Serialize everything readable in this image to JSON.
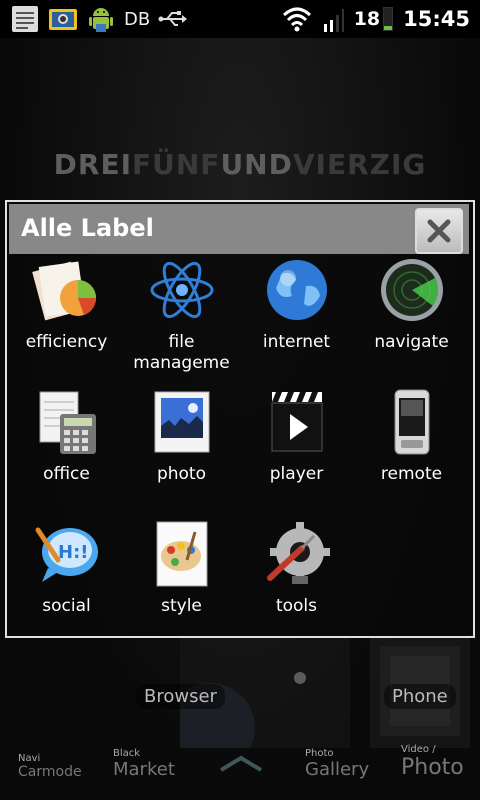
{
  "status_bar": {
    "carrier_text": "DB",
    "battery_level": "18",
    "time": "15:45",
    "icons": [
      "notes-icon",
      "screenshot-icon",
      "android-icon",
      "usb-icon",
      "wifi-icon",
      "signal-icon",
      "battery-icon"
    ]
  },
  "home": {
    "brand": {
      "part1": "DREI",
      "part2": "FÜNF",
      "part3": "UND",
      "part4": "VIERZIG"
    },
    "browser_label": "Browser",
    "phone_label": "Phone"
  },
  "dialog": {
    "title": "Alle Label",
    "items": [
      {
        "label": "efficiency",
        "icon": "efficiency-icon"
      },
      {
        "label": "file manageme",
        "icon": "atom-icon"
      },
      {
        "label": "internet",
        "icon": "globe-icon"
      },
      {
        "label": "navigate",
        "icon": "radar-icon"
      },
      {
        "label": "office",
        "icon": "calculator-icon"
      },
      {
        "label": "photo",
        "icon": "photo-icon"
      },
      {
        "label": "player",
        "icon": "clapperboard-icon"
      },
      {
        "label": "remote",
        "icon": "remote-phone-icon"
      },
      {
        "label": "social",
        "icon": "chat-bubble-icon"
      },
      {
        "label": "style",
        "icon": "palette-icon"
      },
      {
        "label": "tools",
        "icon": "tools-icon"
      }
    ]
  },
  "dock": {
    "items": [
      {
        "small": "Navi",
        "big": "Carmode"
      },
      {
        "small": "Black",
        "big": "Market"
      },
      {
        "small": "Photo",
        "big": "Gallery"
      },
      {
        "small": "Video /",
        "big": "Photo"
      }
    ]
  },
  "colors": {
    "header_bg": "#888888",
    "dialog_border": "#e0e0e0",
    "battery_green": "#6cc04a"
  }
}
